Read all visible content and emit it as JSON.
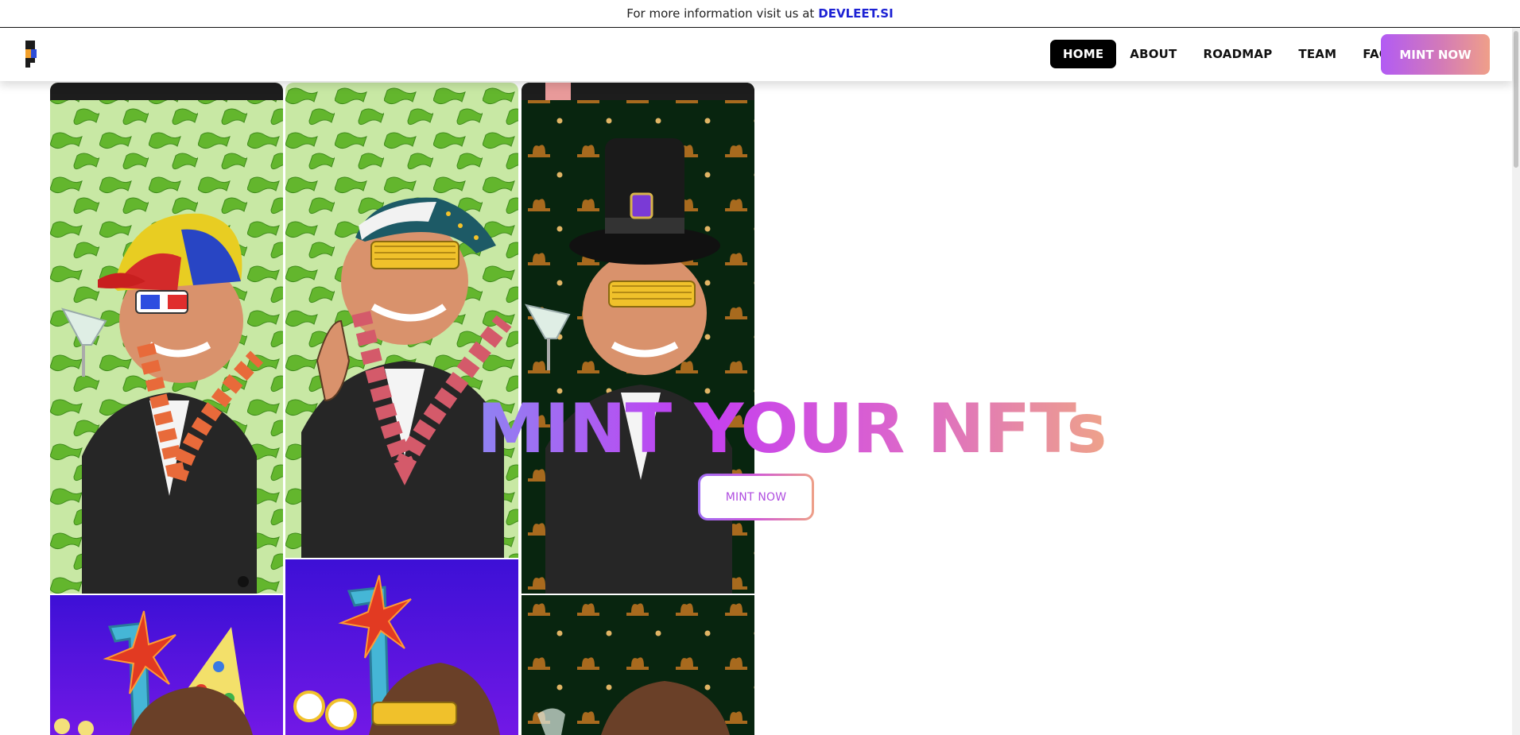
{
  "announcement": {
    "prefix": "For more information visit us at",
    "link_text": "DEVLEET.SI"
  },
  "nav": {
    "items": [
      {
        "label": "HOME",
        "active": true
      },
      {
        "label": "ABOUT",
        "active": false
      },
      {
        "label": "ROADMAP",
        "active": false
      },
      {
        "label": "TEAM",
        "active": false
      },
      {
        "label": "FAQ",
        "active": false
      }
    ],
    "mint_button": "MINT NOW"
  },
  "hero": {
    "title": "MINT YOUR NFTs",
    "button": "MINT NOW"
  },
  "colors": {
    "gradient_start": "#b25bf4",
    "gradient_mid": "#d37ab8",
    "gradient_end": "#ef9f89",
    "active_nav_bg": "#000000",
    "link_blue": "#1d22d4"
  },
  "gallery": [
    {
      "background": "green dollar bills",
      "accessory": "propeller cap, 3D glasses, martini glass, flower lei"
    },
    {
      "background": "green dollar bills",
      "accessory": "bandana, gold shutter shades, flower lei"
    },
    {
      "background": "dark green ornament pattern",
      "accessory": "top hat with gem, gold shutter shades, martini glass"
    },
    {
      "background": "purple neon sign",
      "accessory": "party hat"
    },
    {
      "background": "purple neon sign",
      "accessory": "gold shutter shades"
    },
    {
      "background": "dark green ornament pattern",
      "accessory": "martini glass"
    }
  ]
}
